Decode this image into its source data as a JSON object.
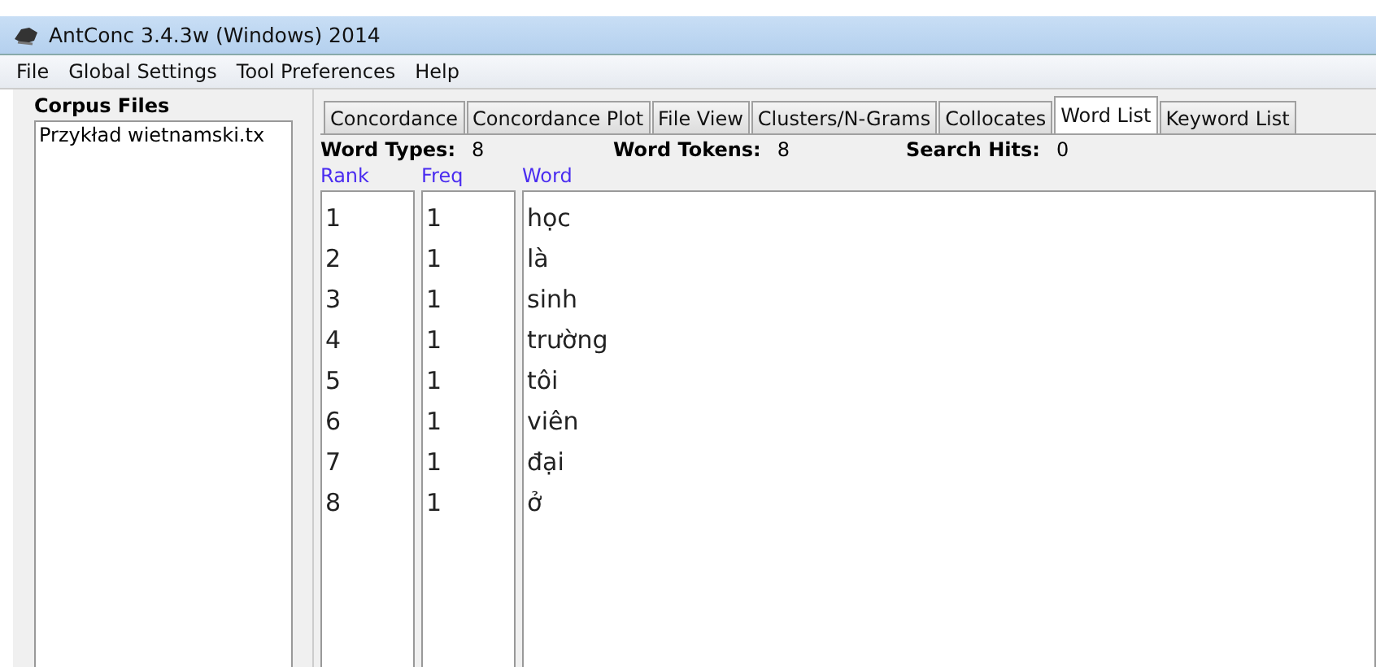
{
  "window": {
    "title": "AntConc 3.4.3w (Windows) 2014"
  },
  "menu": [
    "File",
    "Global Settings",
    "Tool Preferences",
    "Help"
  ],
  "corpus_files": {
    "title": "Corpus Files",
    "items": [
      {
        "name": "Przykład wietnamski.tx",
        "selected": false
      }
    ]
  },
  "tabs": [
    {
      "label": "Concordance",
      "selected": false
    },
    {
      "label": "Concordance Plot",
      "selected": false
    },
    {
      "label": "File View",
      "selected": false
    },
    {
      "label": "Clusters/N-Grams",
      "selected": false
    },
    {
      "label": "Collocates",
      "selected": false
    },
    {
      "label": "Word List",
      "selected": true
    },
    {
      "label": "Keyword List",
      "selected": false
    }
  ],
  "stats": [
    {
      "label": "Word Types:",
      "value": "8"
    },
    {
      "label": "Word Tokens:",
      "value": "8"
    },
    {
      "label": "Search Hits:",
      "value": "0"
    }
  ],
  "table": {
    "columns": [
      "Rank",
      "Freq",
      "Word"
    ],
    "rows": [
      [
        "1",
        "1",
        "học"
      ],
      [
        "2",
        "1",
        "là"
      ],
      [
        "3",
        "1",
        "sinh"
      ],
      [
        "4",
        "1",
        "trường"
      ],
      [
        "5",
        "1",
        "tôi"
      ],
      [
        "6",
        "1",
        "viên"
      ],
      [
        "7",
        "1",
        "đại"
      ],
      [
        "8",
        "1",
        "ở"
      ]
    ]
  }
}
